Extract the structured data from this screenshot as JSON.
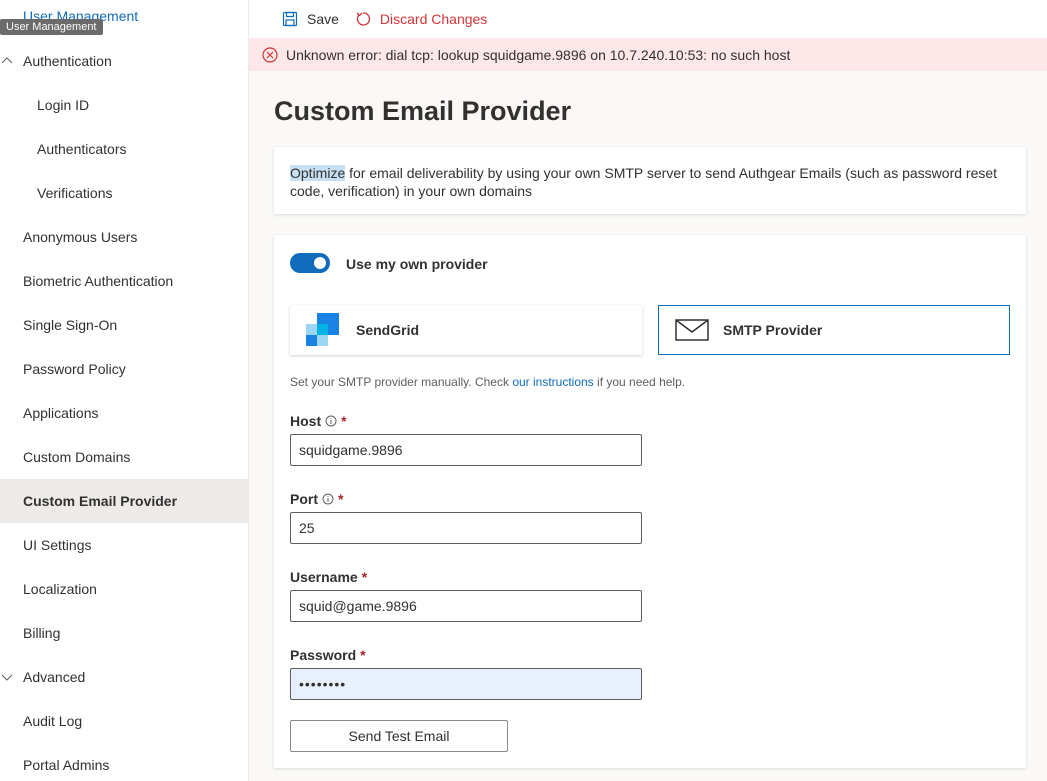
{
  "sidebar": {
    "top_item": "User Management",
    "tooltip": "User Management",
    "items": [
      {
        "label": "Authentication",
        "expanded": true
      },
      {
        "label": "Login ID"
      },
      {
        "label": "Authenticators"
      },
      {
        "label": "Verifications"
      },
      {
        "label": "Anonymous Users"
      },
      {
        "label": "Biometric Authentication"
      },
      {
        "label": "Single Sign-On"
      },
      {
        "label": "Password Policy"
      },
      {
        "label": "Applications"
      },
      {
        "label": "Custom Domains"
      },
      {
        "label": "Custom Email Provider",
        "active": true
      },
      {
        "label": "UI Settings"
      },
      {
        "label": "Localization"
      },
      {
        "label": "Billing"
      },
      {
        "label": "Advanced",
        "expanded": true
      },
      {
        "label": "Audit Log"
      },
      {
        "label": "Portal Admins"
      }
    ]
  },
  "toolbar": {
    "save_label": "Save",
    "discard_label": "Discard Changes"
  },
  "error": {
    "message": "Unknown error: dial tcp: lookup squidgame.9896 on 10.7.240.10:53: no such host"
  },
  "page": {
    "title": "Custom Email Provider",
    "description_highlight": "Optimize",
    "description_rest": " for email deliverability by using your own SMTP server to send Authgear Emails (such as password reset code, verification) in your own domains"
  },
  "form": {
    "toggle_label": "Use my own provider",
    "toggle_on": true,
    "providers": {
      "sendgrid": "SendGrid",
      "smtp": "SMTP Provider",
      "selected": "smtp"
    },
    "hint_before": "Set your SMTP provider manually. Check ",
    "hint_link": "our instructions",
    "hint_after": " if you need help.",
    "host": {
      "label": "Host",
      "value": "squidgame.9896"
    },
    "port": {
      "label": "Port",
      "value": "25"
    },
    "username": {
      "label": "Username",
      "value": "squid@game.9896"
    },
    "password": {
      "label": "Password",
      "value": "••••••••"
    },
    "required_mark": "*",
    "test_button": "Send Test Email"
  },
  "colors": {
    "accent": "#0f6cbd",
    "error_bg": "#fde7e9",
    "error": "#d13438",
    "active_nav_bg": "#edebe9"
  }
}
